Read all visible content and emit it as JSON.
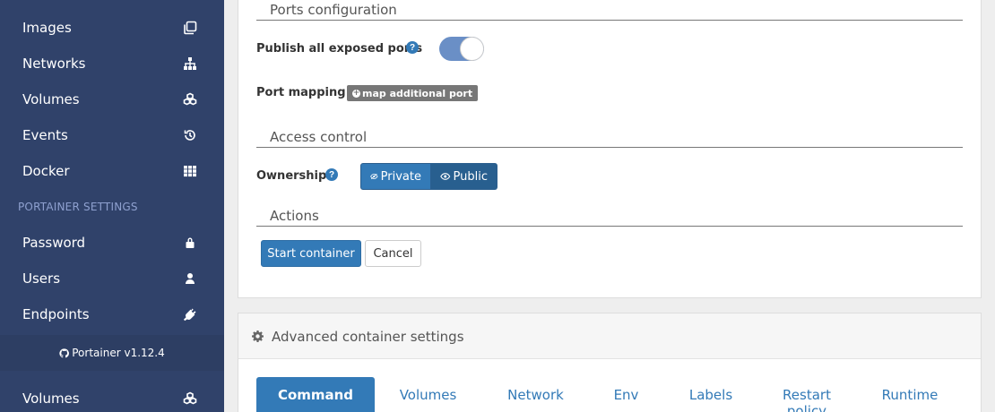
{
  "sidebar": {
    "items": [
      {
        "label": "Images",
        "icon": "clone-icon"
      },
      {
        "label": "Networks",
        "icon": "sitemap-icon"
      },
      {
        "label": "Volumes",
        "icon": "cubes-icon"
      },
      {
        "label": "Events",
        "icon": "history-icon"
      },
      {
        "label": "Docker",
        "icon": "th-icon"
      }
    ],
    "settings_title": "PORTAINER SETTINGS",
    "settings_items": [
      {
        "label": "Password",
        "icon": "lock-icon"
      },
      {
        "label": "Users",
        "icon": "user-icon"
      },
      {
        "label": "Endpoints",
        "icon": "plug-icon"
      }
    ],
    "footer": "Portainer v1.12.4",
    "bottom_item": {
      "label": "Volumes",
      "icon": "cubes-icon"
    }
  },
  "ports": {
    "section_title": "Ports configuration",
    "publish_label": "Publish all exposed ports",
    "publish_enabled": true,
    "mapping_label": "Port mapping",
    "map_button": "map additional port"
  },
  "access": {
    "section_title": "Access control",
    "ownership_label": "Ownership",
    "private_label": "Private",
    "public_label": "Public",
    "selected": "Public"
  },
  "actions": {
    "section_title": "Actions",
    "start_label": "Start container",
    "cancel_label": "Cancel"
  },
  "advanced": {
    "title": "Advanced container settings",
    "tabs": [
      "Command",
      "Volumes",
      "Network",
      "Env",
      "Labels",
      "Restart policy",
      "Runtime"
    ],
    "active_tab": "Command"
  },
  "colors": {
    "sidebar_bg": "#30426a",
    "primary": "#337ab7",
    "toggle_on": "#6a8fc6"
  }
}
